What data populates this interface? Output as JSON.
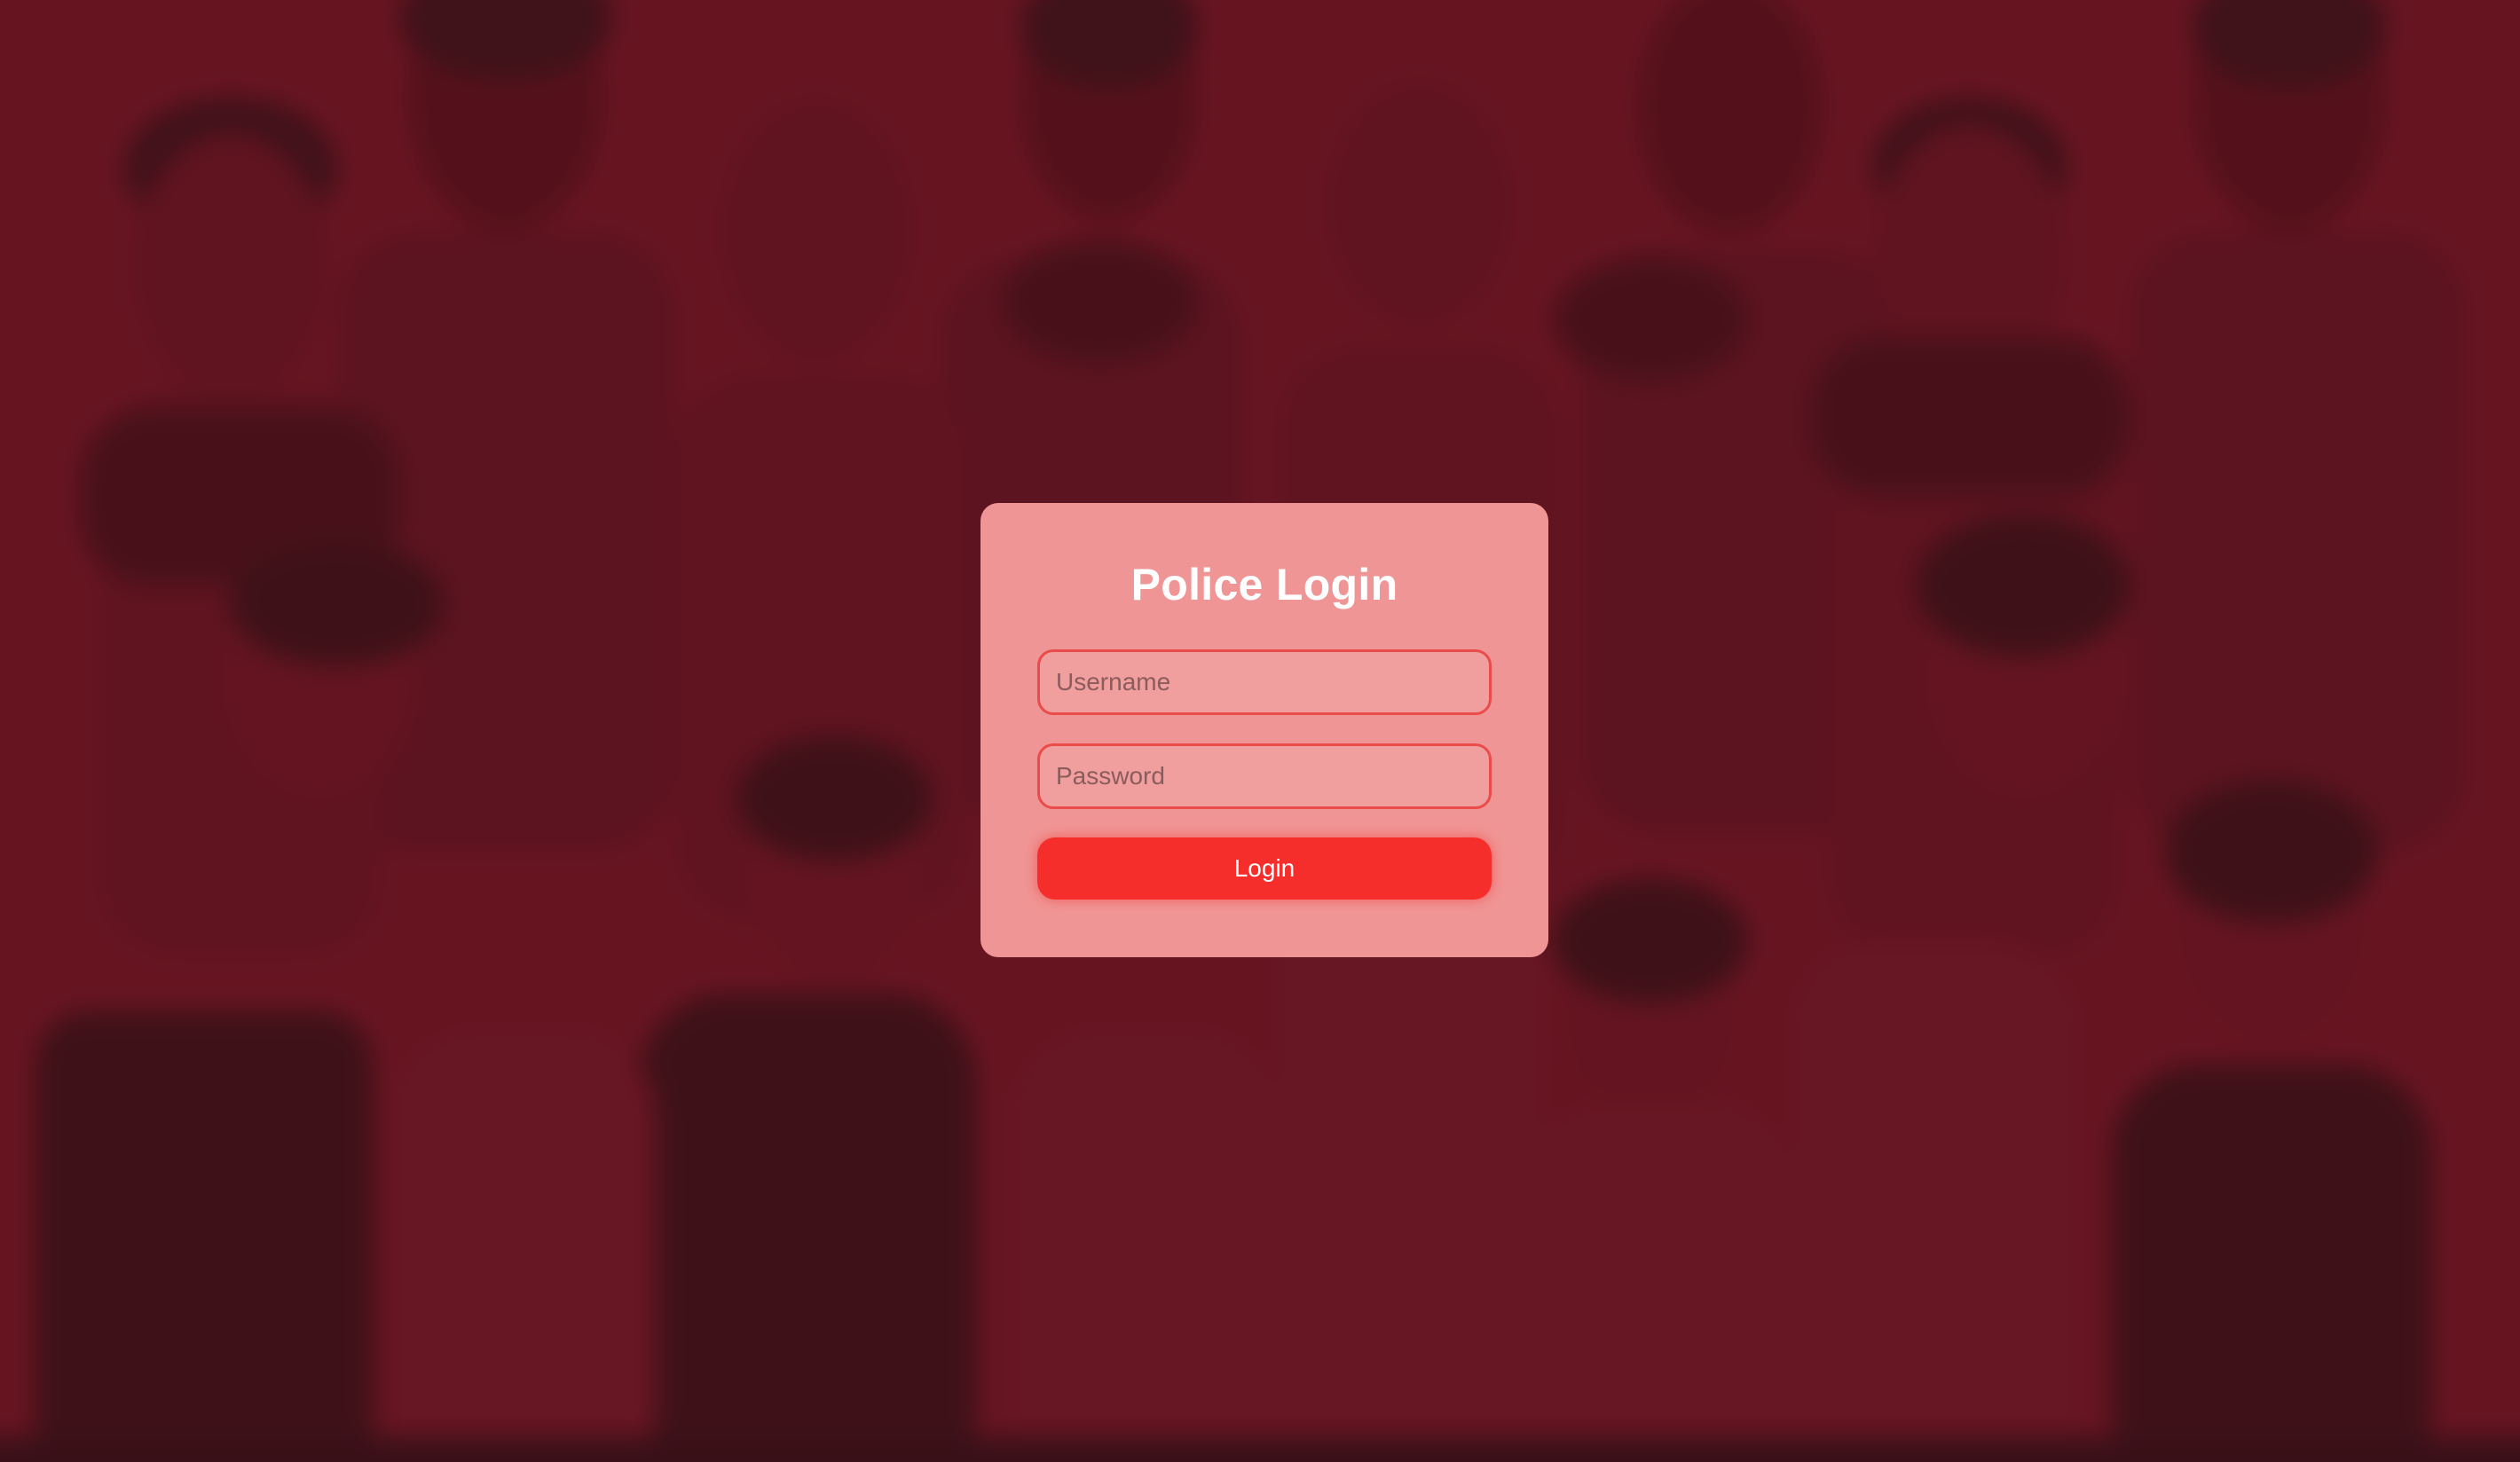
{
  "login": {
    "title": "Police Login",
    "username_placeholder": "Username",
    "password_placeholder": "Password",
    "submit_label": "Login"
  },
  "background": {
    "description_icon": "crowd-silhouette-image"
  },
  "colors": {
    "background": "#5e1420",
    "card": "#f09595",
    "field_border": "#ea4b4b",
    "button": "#f52e2b"
  }
}
